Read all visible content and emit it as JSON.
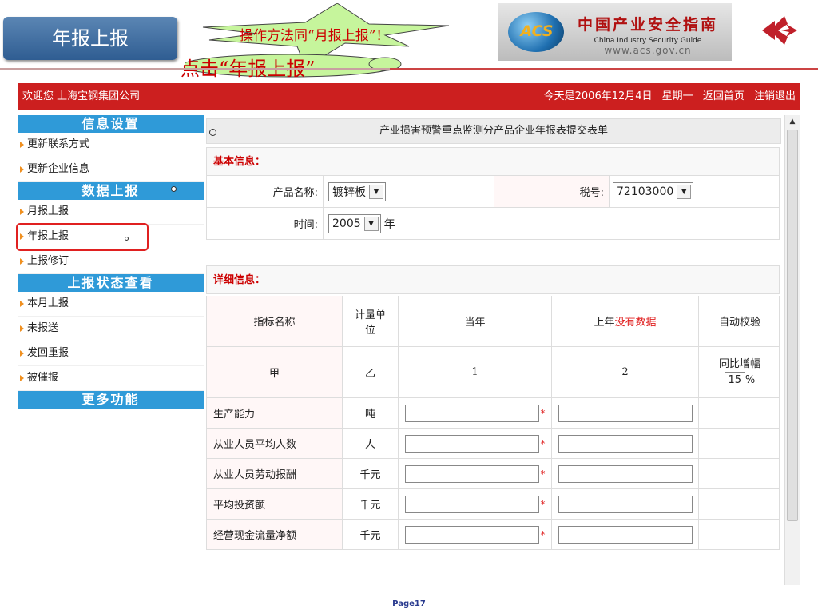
{
  "slide": {
    "title": "年报上报",
    "callout_top": "操作方法同“月报上报”！",
    "callout_bottom": "点击“年报上报”",
    "page_number": "Page17"
  },
  "logo": {
    "acs": "ACS",
    "cn": "中国产业安全指南",
    "en": "China Industry Security Guide",
    "url": "www.acs.gov.cn"
  },
  "topbar": {
    "welcome": "欢迎您 上海宝钢集团公司",
    "date": "今天是2006年12月4日",
    "weekday": "星期一",
    "home": "返回首页",
    "logout": "注销退出",
    "color": "#cc1f1f"
  },
  "sidebar": {
    "group1": "信息设置",
    "group1_items": [
      "更新联系方式",
      "更新企业信息"
    ],
    "group2": "数据上报",
    "group2_items": [
      "月报上报",
      "年报上报",
      "上报修订"
    ],
    "group3": "上报状态查看",
    "group3_items": [
      "本月上报",
      "未报送",
      "发回重报",
      "被催报"
    ],
    "group4": "更多功能"
  },
  "form": {
    "title": "产业损害预警重点监测分产品企业年报表提交表单",
    "basic_label": "基本信息：",
    "product_label": "产品名称:",
    "product_value": "镀锌板",
    "tax_label": "税号:",
    "tax_value": "72103000",
    "time_label": "时间:",
    "year_value": "2005",
    "year_unit": "年",
    "detail_label": "详细信息："
  },
  "table": {
    "headers": {
      "name": "指标名称",
      "unit": "计量单位",
      "current": "当年",
      "prev_prefix": "上年",
      "prev_note": "没有数据",
      "check": "自动校验"
    },
    "index_row": {
      "name": "甲",
      "unit": "乙",
      "current": "1",
      "prev": "2",
      "check_label": "同比增幅",
      "check_value": "15",
      "check_unit": "%"
    },
    "rows": [
      {
        "name": "生产能力",
        "unit": "吨"
      },
      {
        "name": "从业人员平均人数",
        "unit": "人"
      },
      {
        "name": "从业人员劳动报酬",
        "unit": "千元"
      },
      {
        "name": "平均投资额",
        "unit": "千元"
      },
      {
        "name": "经营现金流量净额",
        "unit": "千元"
      }
    ],
    "required_mark": "*"
  }
}
